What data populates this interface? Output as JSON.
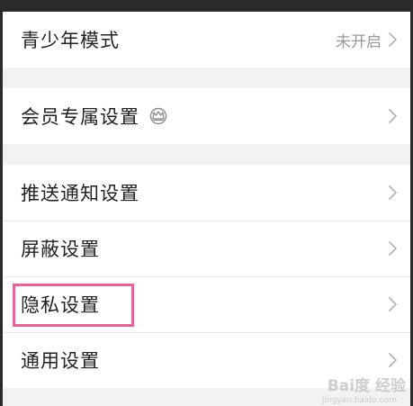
{
  "groups": [
    {
      "rows": [
        {
          "label": "青少年模式",
          "value": "未开启"
        }
      ]
    },
    {
      "rows": [
        {
          "label": "会员专属设置",
          "badge_icon": "crown-icon"
        }
      ]
    },
    {
      "rows": [
        {
          "label": "推送通知设置"
        },
        {
          "label": "屏蔽设置"
        },
        {
          "label": "隐私设置"
        },
        {
          "label": "通用设置"
        }
      ]
    }
  ],
  "watermark": {
    "text": "Bai度 经验",
    "sub": "jingyan.baidu.com"
  },
  "colors": {
    "background": "#f2f2f2",
    "highlight": "#e0669a",
    "value_text": "#999999",
    "chevron": "#b5b5b5"
  }
}
